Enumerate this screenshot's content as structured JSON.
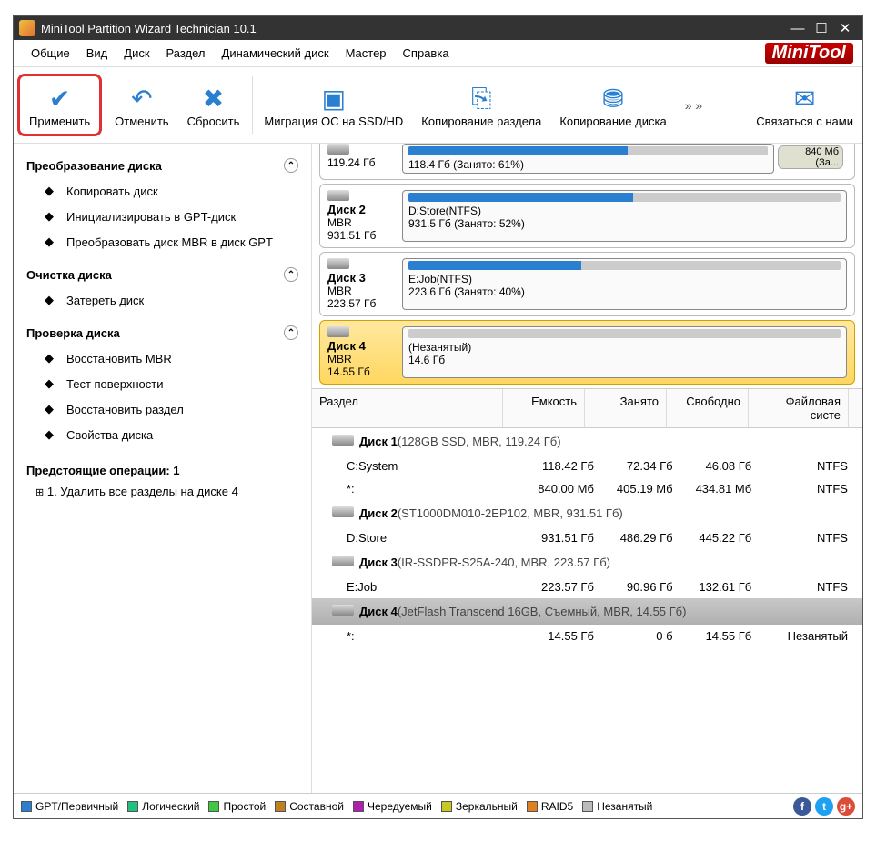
{
  "title": "MiniTool Partition Wizard Technician 10.1",
  "menu": [
    "Общие",
    "Вид",
    "Диск",
    "Раздел",
    "Динамический диск",
    "Мастер",
    "Справка"
  ],
  "logo": "MiniTool",
  "toolbar": {
    "apply": "Применить",
    "undo": "Отменить",
    "discard": "Сбросить",
    "migrate": "Миграция ОС на SSD/HD",
    "copypart": "Копирование раздела",
    "copydisk": "Копирование диска",
    "contact": "Связаться с нами",
    "more": "» »"
  },
  "sidebar": {
    "groups": [
      {
        "title": "Преобразование диска",
        "items": [
          "Копировать диск",
          "Инициализировать в GPT-диск",
          "Преобразовать диск MBR в диск GPT"
        ]
      },
      {
        "title": "Очистка диска",
        "items": [
          "Затереть диск"
        ]
      },
      {
        "title": "Проверка диска",
        "items": [
          "Восстановить MBR",
          "Тест поверхности",
          "Восстановить раздел",
          "Свойства диска"
        ]
      }
    ],
    "pending_title": "Предстоящие операции: 1",
    "pending_items": [
      "1. Удалить все разделы на диске 4"
    ]
  },
  "diskmap": {
    "top_trunc": {
      "size": "119.24 Гб",
      "bar": "118.4 Гб (Занято: 61%)",
      "side": "840 Мб (За..."
    },
    "rows": [
      {
        "name": "Диск 2",
        "type": "MBR",
        "size": "931.51 Гб",
        "bar_label": "D:Store(NTFS)",
        "bar_detail": "931.5 Гб (Занято: 52%)",
        "used_pct": 52
      },
      {
        "name": "Диск 3",
        "type": "MBR",
        "size": "223.57 Гб",
        "bar_label": "E:Job(NTFS)",
        "bar_detail": "223.6 Гб (Занято: 40%)",
        "used_pct": 40
      },
      {
        "name": "Диск 4",
        "type": "MBR",
        "size": "14.55 Гб",
        "bar_label": "(Незанятый)",
        "bar_detail": "14.6 Гб",
        "used_pct": 0,
        "selected": true,
        "unalloc": true
      }
    ]
  },
  "columns": [
    "Раздел",
    "Емкость",
    "Занято",
    "Свободно",
    "Файловая систе"
  ],
  "table": [
    {
      "type": "disk",
      "name": "Диск 1",
      "info": "(128GB SSD, MBR, 119.24 Гб)"
    },
    {
      "type": "part",
      "name": "C:System",
      "cap": "118.42 Гб",
      "used": "72.34 Гб",
      "free": "46.08 Гб",
      "fs": "NTFS"
    },
    {
      "type": "part",
      "name": "*:",
      "cap": "840.00 Мб",
      "used": "405.19 Мб",
      "free": "434.81 Мб",
      "fs": "NTFS"
    },
    {
      "type": "disk",
      "name": "Диск 2",
      "info": "(ST1000DM010-2EP102, MBR, 931.51 Гб)"
    },
    {
      "type": "part",
      "name": "D:Store",
      "cap": "931.51 Гб",
      "used": "486.29 Гб",
      "free": "445.22 Гб",
      "fs": "NTFS"
    },
    {
      "type": "disk",
      "name": "Диск 3",
      "info": "(IR-SSDPR-S25A-240, MBR, 223.57 Гб)"
    },
    {
      "type": "part",
      "name": "E:Job",
      "cap": "223.57 Гб",
      "used": "90.96 Гб",
      "free": "132.61 Гб",
      "fs": "NTFS"
    },
    {
      "type": "disk",
      "name": "Диск 4",
      "info": "(JetFlash Transcend 16GB, Съемный, MBR, 14.55 Гб)",
      "selected": true
    },
    {
      "type": "part",
      "name": "*:",
      "cap": "14.55 Гб",
      "used": "0 б",
      "free": "14.55 Гб",
      "fs": "Незанятый"
    }
  ],
  "legend": [
    {
      "label": "GPT/Первичный",
      "color": "#2a7fd0"
    },
    {
      "label": "Логический",
      "color": "#20c080"
    },
    {
      "label": "Простой",
      "color": "#40c840"
    },
    {
      "label": "Составной",
      "color": "#c08020"
    },
    {
      "label": "Чередуемый",
      "color": "#b020b0"
    },
    {
      "label": "Зеркальный",
      "color": "#c8c820"
    },
    {
      "label": "RAID5",
      "color": "#e08020"
    },
    {
      "label": "Незанятый",
      "color": "#bbbbbb"
    }
  ]
}
